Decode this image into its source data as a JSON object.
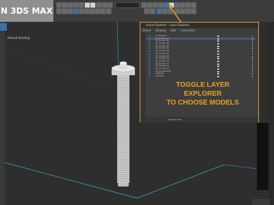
{
  "title_banner": "N 3DS MAX",
  "viewport": {
    "label": "Default Shading"
  },
  "layer_explorer": {
    "title": "Scene Explorer - Layer Explorer",
    "menu": [
      "Select",
      "Display",
      "Edit",
      "Customize"
    ],
    "rows": [
      {
        "name": "0 (default)",
        "selected": false
      },
      {
        "name": "01_Screw_01",
        "selected": true
      },
      {
        "name": "01_Screw_02",
        "selected": false
      },
      {
        "name": "01_Screw_03",
        "selected": false
      },
      {
        "name": "01_Screw_04",
        "selected": false
      },
      {
        "name": "01_Screw_05",
        "selected": false
      },
      {
        "name": "01_Screw_06",
        "selected": false
      },
      {
        "name": "01_Screw_07",
        "selected": false
      },
      {
        "name": "01_Screw_08",
        "selected": false
      },
      {
        "name": "01_Screw_09",
        "selected": false
      },
      {
        "name": "01_Screw_10",
        "selected": false
      },
      {
        "name": "01_Screw_11",
        "selected": false
      },
      {
        "name": "01_Screw_12",
        "selected": false
      },
      {
        "name": "01_Screw_13",
        "selected": false
      },
      {
        "name": "Screw_Bushing",
        "selected": false
      },
      {
        "name": "Lighting",
        "selected": false
      },
      {
        "name": "Camera",
        "selected": false
      }
    ],
    "status_label": "Selection Set:"
  },
  "callout": {
    "line1": "TOGGLE LAYER EXPLORER",
    "line2": "TO CHOOSE MODELS"
  },
  "colors": {
    "accent": "#e0a321",
    "viewport_bg": "#2e2e2e",
    "toolbar_bg": "#3b3b3b"
  },
  "icons": [
    "undo-icon",
    "redo-icon",
    "link-icon",
    "select-icon",
    "move-icon",
    "rotate-icon",
    "scale-icon",
    "layer-explorer-icon",
    "render-icon"
  ]
}
